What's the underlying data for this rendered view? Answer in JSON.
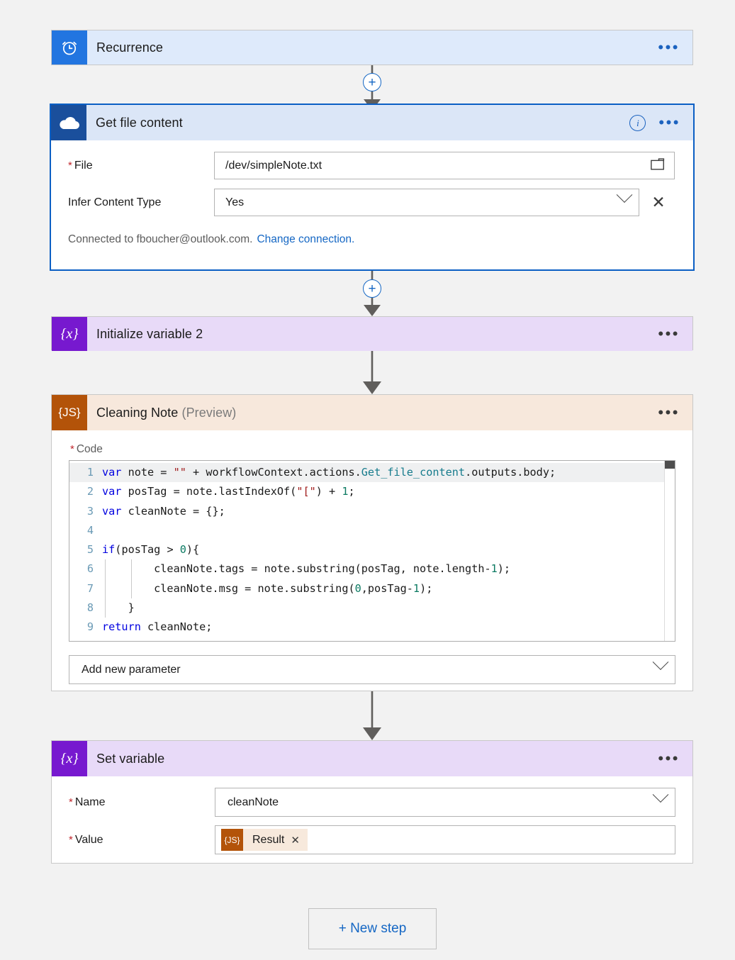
{
  "flow": {
    "steps": [
      {
        "id": "recurrence",
        "title": "Recurrence",
        "icon_name": "alarm-clock-icon",
        "icon_glyph": "⏰",
        "icon_bg": "#2275e0",
        "header_bg": "#deeafb",
        "menu_label": "•••"
      },
      {
        "id": "get-file-content",
        "title": "Get file content",
        "icon_name": "onedrive-cloud-icon",
        "icon_bg": "#1a4f9c",
        "header_bg": "#dbe6f7",
        "menu_label": "•••",
        "info_label": "i",
        "fields": {
          "file": {
            "label": "File",
            "required": true,
            "value": "/dev/simpleNote.txt",
            "picker_icon": "folder-icon"
          },
          "infer": {
            "label": "Infer Content Type",
            "required": false,
            "value": "Yes",
            "clear_label": "✕"
          }
        },
        "connection": {
          "text": "Connected to fboucher@outlook.com.",
          "link": "Change connection."
        }
      },
      {
        "id": "initialize-variable-2",
        "title": "Initialize variable 2",
        "icon_name": "variable-icon",
        "icon_glyph": "{x}",
        "icon_bg": "#7719cf",
        "header_bg": "#e8daf8",
        "menu_label": "•••"
      },
      {
        "id": "cleaning-note",
        "title": "Cleaning Note",
        "title_suffix": "(Preview)",
        "icon_name": "javascript-icon",
        "icon_glyph": "{JS}",
        "icon_bg": "#b35309",
        "header_bg": "#f7e8dc",
        "menu_label": "•••",
        "code_label": "Code",
        "code_required": true,
        "add_parameter_placeholder": "Add new parameter"
      },
      {
        "id": "set-variable",
        "title": "Set variable",
        "icon_name": "variable-icon",
        "icon_glyph": "{x}",
        "icon_bg": "#7719cf",
        "header_bg": "#e8daf8",
        "menu_label": "•••",
        "fields": {
          "name": {
            "label": "Name",
            "required": true,
            "value": "cleanNote"
          },
          "value": {
            "label": "Value",
            "required": true,
            "token": {
              "icon_glyph": "{JS}",
              "label": "Result",
              "remove_label": "✕"
            }
          }
        }
      }
    ],
    "connectors": {
      "plus_label": "+"
    },
    "new_step_button": "+ New step"
  },
  "code": {
    "lines": [
      {
        "n": "1",
        "active": true,
        "tokens": [
          {
            "t": "var",
            "c": "kw"
          },
          {
            "t": " note = ",
            "c": "ct"
          },
          {
            "t": "\"\"",
            "c": "str"
          },
          {
            "t": " + workflowContext.actions.",
            "c": "ct"
          },
          {
            "t": "Get_file_content",
            "c": "mem"
          },
          {
            "t": ".outputs.body;",
            "c": "ct"
          }
        ]
      },
      {
        "n": "2",
        "active": false,
        "tokens": [
          {
            "t": "var",
            "c": "kw"
          },
          {
            "t": " posTag = note.lastIndexOf(",
            "c": "ct"
          },
          {
            "t": "\"[\"",
            "c": "str"
          },
          {
            "t": ") + ",
            "c": "ct"
          },
          {
            "t": "1",
            "c": "num"
          },
          {
            "t": ";",
            "c": "ct"
          }
        ]
      },
      {
        "n": "3",
        "active": false,
        "tokens": [
          {
            "t": "var",
            "c": "kw"
          },
          {
            "t": " cleanNote = {};",
            "c": "ct"
          }
        ]
      },
      {
        "n": "4",
        "active": false,
        "tokens": [
          {
            "t": "",
            "c": "ct"
          }
        ]
      },
      {
        "n": "5",
        "active": false,
        "tokens": [
          {
            "t": "if",
            "c": "kw"
          },
          {
            "t": "(posTag > ",
            "c": "ct"
          },
          {
            "t": "0",
            "c": "num"
          },
          {
            "t": "){",
            "c": "ct"
          }
        ]
      },
      {
        "n": "6",
        "active": false,
        "tokens": [
          {
            "t": "        cleanNote.tags = note.substring(posTag, note.length-",
            "c": "ct"
          },
          {
            "t": "1",
            "c": "num"
          },
          {
            "t": ");",
            "c": "ct"
          }
        ]
      },
      {
        "n": "7",
        "active": false,
        "tokens": [
          {
            "t": "        cleanNote.msg = note.substring(",
            "c": "ct"
          },
          {
            "t": "0",
            "c": "num"
          },
          {
            "t": ",posTag-",
            "c": "ct"
          },
          {
            "t": "1",
            "c": "num"
          },
          {
            "t": ");",
            "c": "ct"
          }
        ]
      },
      {
        "n": "8",
        "active": false,
        "tokens": [
          {
            "t": "    }",
            "c": "ct"
          }
        ]
      },
      {
        "n": "9",
        "active": false,
        "tokens": [
          {
            "t": "return",
            "c": "kw"
          },
          {
            "t": " cleanNote;",
            "c": "ct"
          }
        ]
      }
    ]
  }
}
